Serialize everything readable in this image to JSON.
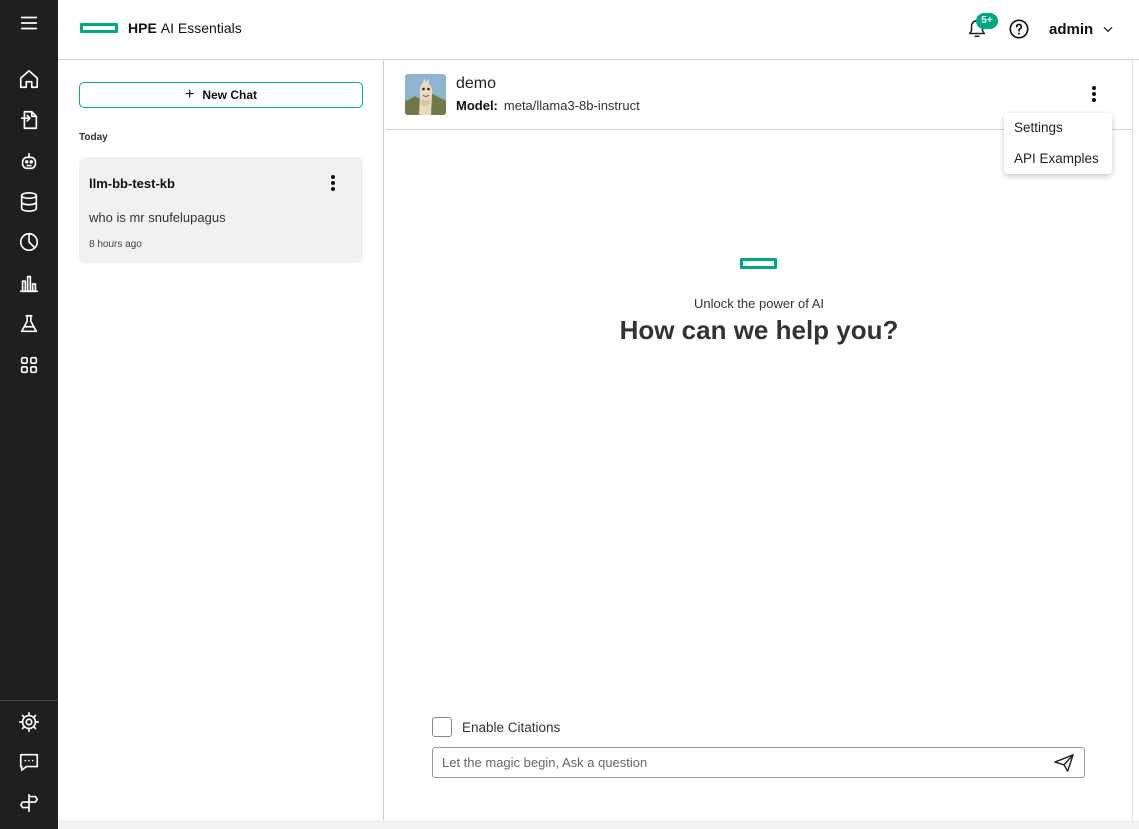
{
  "app": {
    "brand_strong": "HPE",
    "brand_light": "AI Essentials",
    "notification_badge": "5+",
    "user_name": "admin",
    "accent_color": "#01a982"
  },
  "rail": {
    "top_icons": [
      "menu-icon",
      "home-icon",
      "document-icon",
      "robot-icon",
      "database-icon",
      "pie-chart-icon",
      "bar-chart-icon",
      "flask-icon",
      "apps-icon"
    ],
    "bottom_icons": [
      "gear-icon",
      "chat-icon",
      "signpost-icon"
    ]
  },
  "history": {
    "new_chat_label": "New Chat",
    "group_label": "Today",
    "chats": [
      {
        "title": "llm-bb-test-kb",
        "message": "who is mr snufelupagus",
        "time": "8 hours ago"
      }
    ]
  },
  "chat": {
    "assistant_name": "demo",
    "model_label": "Model:",
    "model_name": "meta/llama3-8b-instruct",
    "menu": [
      "Settings",
      "API Examples"
    ],
    "hero_subtitle": "Unlock the power of AI",
    "hero_title": "How can we help you?",
    "citations_label": "Enable Citations",
    "citations_checked": false,
    "input_placeholder": "Let the magic begin, Ask a question",
    "input_value": ""
  }
}
